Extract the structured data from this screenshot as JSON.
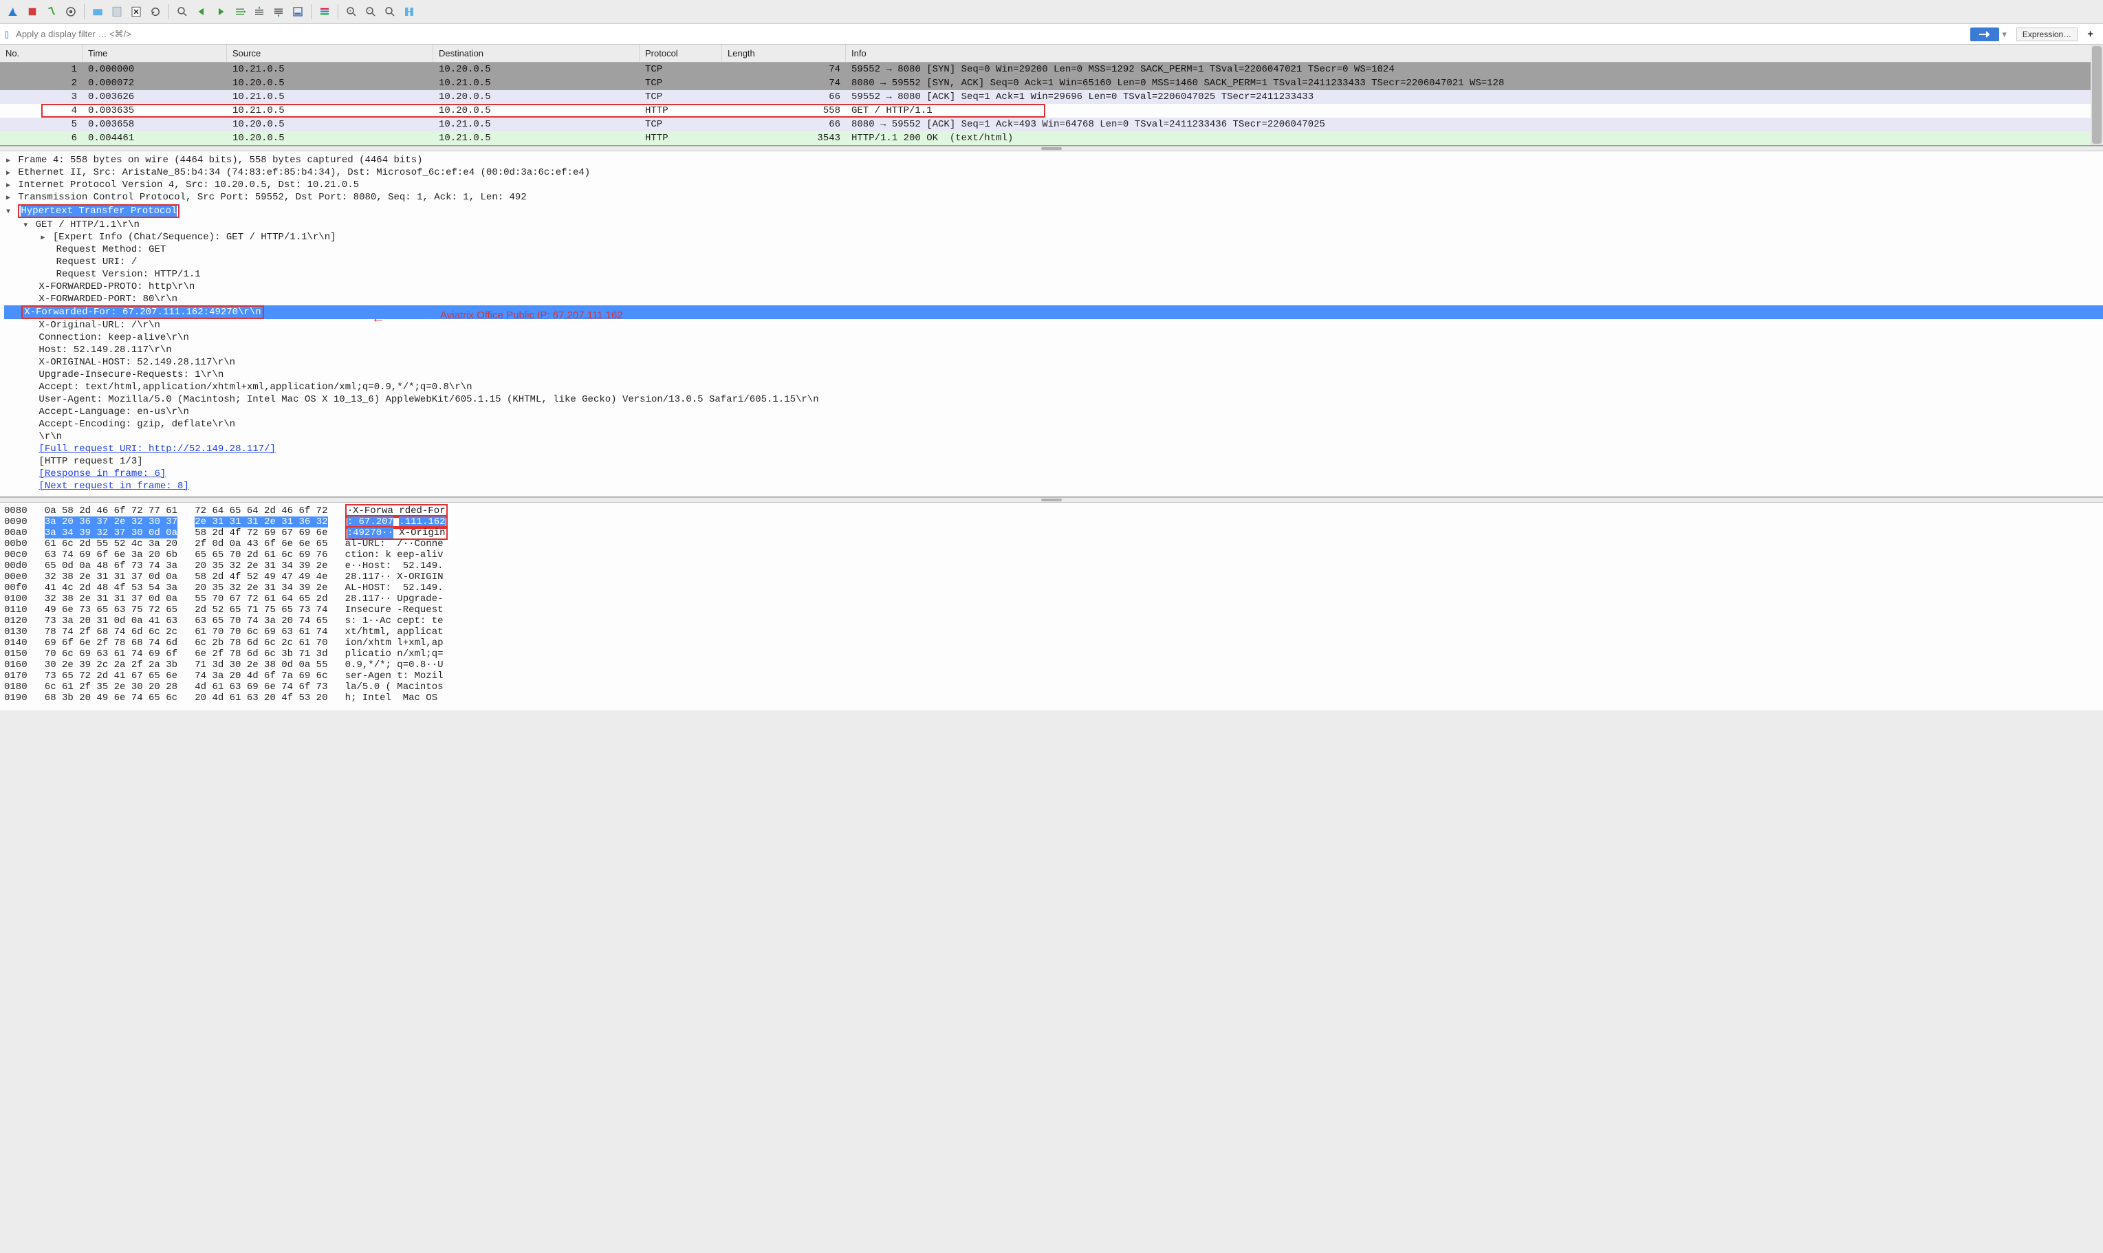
{
  "filter": {
    "placeholder": "Apply a display filter … <⌘/>",
    "expression": "Expression…"
  },
  "columns": {
    "no": "No.",
    "time": "Time",
    "src": "Source",
    "dst": "Destination",
    "proto": "Protocol",
    "len": "Length",
    "info": "Info"
  },
  "packets": [
    {
      "no": "1",
      "time": "0.000000",
      "src": "10.21.0.5",
      "dst": "10.20.0.5",
      "proto": "TCP",
      "len": "74",
      "info": "59552 → 8080 [SYN] Seq=0 Win=29200 Len=0 MSS=1292 SACK_PERM=1 TSval=2206047021 TSecr=0 WS=1024",
      "cls": "gray"
    },
    {
      "no": "2",
      "time": "0.000072",
      "src": "10.20.0.5",
      "dst": "10.21.0.5",
      "proto": "TCP",
      "len": "74",
      "info": "8080 → 59552 [SYN, ACK] Seq=0 Ack=1 Win=65160 Len=0 MSS=1460 SACK_PERM=1 TSval=2411233433 TSecr=2206047021 WS=128",
      "cls": "gray"
    },
    {
      "no": "3",
      "time": "0.003626",
      "src": "10.21.0.5",
      "dst": "10.20.0.5",
      "proto": "TCP",
      "len": "66",
      "info": "59552 → 8080 [ACK] Seq=1 Ack=1 Win=29696 Len=0 TSval=2206047025 TSecr=2411233433",
      "cls": "light"
    },
    {
      "no": "4",
      "time": "0.003635",
      "src": "10.21.0.5",
      "dst": "10.20.0.5",
      "proto": "HTTP",
      "len": "558",
      "info": "GET / HTTP/1.1",
      "cls": "white",
      "boxed": true
    },
    {
      "no": "5",
      "time": "0.003658",
      "src": "10.20.0.5",
      "dst": "10.21.0.5",
      "proto": "TCP",
      "len": "66",
      "info": "8080 → 59552 [ACK] Seq=1 Ack=493 Win=64768 Len=0 TSval=2411233436 TSecr=2206047025",
      "cls": "light"
    },
    {
      "no": "6",
      "time": "0.004461",
      "src": "10.20.0.5",
      "dst": "10.21.0.5",
      "proto": "HTTP",
      "len": "3543",
      "info": "HTTP/1.1 200 OK  (text/html)",
      "cls": "green"
    }
  ],
  "details": {
    "frame": "Frame 4: 558 bytes on wire (4464 bits), 558 bytes captured (4464 bits)",
    "eth": "Ethernet II, Src: AristaNe_85:b4:34 (74:83:ef:85:b4:34), Dst: Microsof_6c:ef:e4 (00:0d:3a:6c:ef:e4)",
    "ip": "Internet Protocol Version 4, Src: 10.20.0.5, Dst: 10.21.0.5",
    "tcp": "Transmission Control Protocol, Src Port: 59552, Dst Port: 8080, Seq: 1, Ack: 1, Len: 492",
    "http": "Hypertext Transfer Protocol",
    "get": "GET / HTTP/1.1\\r\\n",
    "expert": "[Expert Info (Chat/Sequence): GET / HTTP/1.1\\r\\n]",
    "reqm": "Request Method: GET",
    "requ": "Request URI: /",
    "reqv": "Request Version: HTTP/1.1",
    "xfp": "X-FORWARDED-PROTO: http\\r\\n",
    "xfport": "X-FORWARDED-PORT: 80\\r\\n",
    "xff": "X-Forwarded-For: 67.207.111.162:49270\\r\\n",
    "xorig": "X-Original-URL: /\\r\\n",
    "conn": "Connection: keep-alive\\r\\n",
    "host": "Host: 52.149.28.117\\r\\n",
    "xohost": "X-ORIGINAL-HOST: 52.149.28.117\\r\\n",
    "uir": "Upgrade-Insecure-Requests: 1\\r\\n",
    "accept": "Accept: text/html,application/xhtml+xml,application/xml;q=0.9,*/*;q=0.8\\r\\n",
    "ua": "User-Agent: Mozilla/5.0 (Macintosh; Intel Mac OS X 10_13_6) AppleWebKit/605.1.15 (KHTML, like Gecko) Version/13.0.5 Safari/605.1.15\\r\\n",
    "alang": "Accept-Language: en-us\\r\\n",
    "aenc": "Accept-Encoding: gzip, deflate\\r\\n",
    "crlf": "\\r\\n",
    "furi": "[Full request URI: http://52.149.28.117/]",
    "hreq": "[HTTP request 1/3]",
    "resp": "[Response in frame: 6]",
    "next": "[Next request in frame: 8]"
  },
  "annot": {
    "text": "Aviatrix Office Public IP: 67.207.111.162"
  },
  "hex": [
    {
      "off": "0080",
      "b1": "0a 58 2d 46 6f 72 77 61",
      "b2": "72 64 65 64 2d 46 6f 72",
      "a1": "·X-Forwa",
      "a2": "rded-For",
      "hl": false,
      "box": true
    },
    {
      "off": "0090",
      "b1": "3a 20 36 37 2e 32 30 37",
      "b2": "2e 31 31 31 2e 31 36 32",
      "a1": ": 67.207",
      "a2": ".111.162",
      "hl": true,
      "box": true
    },
    {
      "off": "00a0",
      "b1": "3a 34 39 32 37 30 0d 0a",
      "b2": "58 2d 4f 72 69 67 69 6e",
      "a1": ":49270··",
      "a2": "X-Origin",
      "hl": "partial",
      "box": true
    },
    {
      "off": "00b0",
      "b1": "61 6c 2d 55 52 4c 3a 20",
      "b2": "2f 0d 0a 43 6f 6e 6e 65",
      "a1": "al-URL: ",
      "a2": "/··Conne"
    },
    {
      "off": "00c0",
      "b1": "63 74 69 6f 6e 3a 20 6b",
      "b2": "65 65 70 2d 61 6c 69 76",
      "a1": "ction: k",
      "a2": "eep-aliv"
    },
    {
      "off": "00d0",
      "b1": "65 0d 0a 48 6f 73 74 3a",
      "b2": "20 35 32 2e 31 34 39 2e",
      "a1": "e··Host:",
      "a2": " 52.149."
    },
    {
      "off": "00e0",
      "b1": "32 38 2e 31 31 37 0d 0a",
      "b2": "58 2d 4f 52 49 47 49 4e",
      "a1": "28.117··",
      "a2": "X-ORIGIN"
    },
    {
      "off": "00f0",
      "b1": "41 4c 2d 48 4f 53 54 3a",
      "b2": "20 35 32 2e 31 34 39 2e",
      "a1": "AL-HOST:",
      "a2": " 52.149."
    },
    {
      "off": "0100",
      "b1": "32 38 2e 31 31 37 0d 0a",
      "b2": "55 70 67 72 61 64 65 2d",
      "a1": "28.117··",
      "a2": "Upgrade-"
    },
    {
      "off": "0110",
      "b1": "49 6e 73 65 63 75 72 65",
      "b2": "2d 52 65 71 75 65 73 74",
      "a1": "Insecure",
      "a2": "-Request"
    },
    {
      "off": "0120",
      "b1": "73 3a 20 31 0d 0a 41 63",
      "b2": "63 65 70 74 3a 20 74 65",
      "a1": "s: 1··Ac",
      "a2": "cept: te"
    },
    {
      "off": "0130",
      "b1": "78 74 2f 68 74 6d 6c 2c",
      "b2": "61 70 70 6c 69 63 61 74",
      "a1": "xt/html,",
      "a2": "applicat"
    },
    {
      "off": "0140",
      "b1": "69 6f 6e 2f 78 68 74 6d",
      "b2": "6c 2b 78 6d 6c 2c 61 70",
      "a1": "ion/xhtm",
      "a2": "l+xml,ap"
    },
    {
      "off": "0150",
      "b1": "70 6c 69 63 61 74 69 6f",
      "b2": "6e 2f 78 6d 6c 3b 71 3d",
      "a1": "plicatio",
      "a2": "n/xml;q="
    },
    {
      "off": "0160",
      "b1": "30 2e 39 2c 2a 2f 2a 3b",
      "b2": "71 3d 30 2e 38 0d 0a 55",
      "a1": "0.9,*/*;",
      "a2": "q=0.8··U"
    },
    {
      "off": "0170",
      "b1": "73 65 72 2d 41 67 65 6e",
      "b2": "74 3a 20 4d 6f 7a 69 6c",
      "a1": "ser-Agen",
      "a2": "t: Mozil"
    },
    {
      "off": "0180",
      "b1": "6c 61 2f 35 2e 30 20 28",
      "b2": "4d 61 63 69 6e 74 6f 73",
      "a1": "la/5.0 (",
      "a2": "Macintos"
    },
    {
      "off": "0190",
      "b1": "68 3b 20 49 6e 74 65 6c",
      "b2": "20 4d 61 63 20 4f 53 20",
      "a1": "h; Intel",
      "a2": " Mac OS "
    }
  ]
}
